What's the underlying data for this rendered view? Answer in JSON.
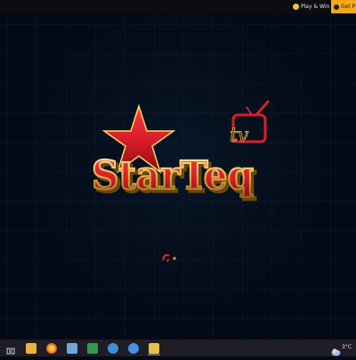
{
  "browser_bar": {
    "play_win_label": "Play & Win",
    "get_label": "Get P"
  },
  "splash": {
    "logo_word": "StarTeq",
    "logo_tag": "tv"
  },
  "tray": {
    "temperature": "3°C"
  },
  "colors": {
    "accent_orange": "#f6a81c",
    "logo_red": "#d81e2a",
    "logo_gold": "#e9b949"
  }
}
